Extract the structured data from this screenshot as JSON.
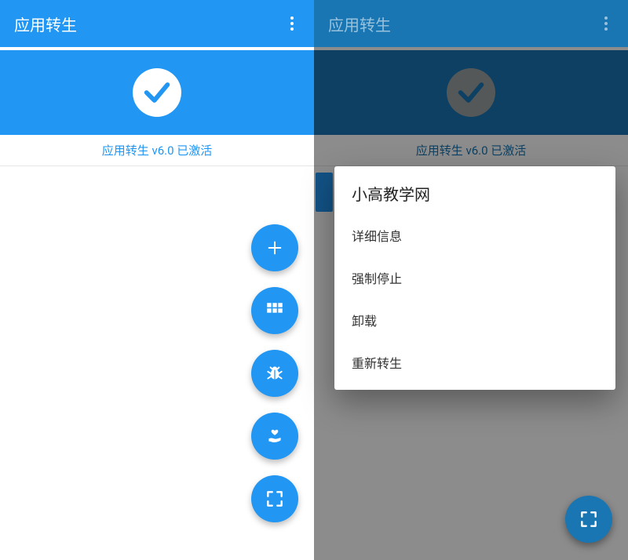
{
  "left": {
    "appbar": {
      "title": "应用转生"
    },
    "status": {
      "text": "应用转生 v6.0 已激活"
    },
    "fabs": {
      "add": "add",
      "grid": "grid",
      "bug": "bug",
      "heart": "heart-hand",
      "expand": "expand"
    }
  },
  "right": {
    "appbar": {
      "title": "应用转生"
    },
    "status": {
      "text": "应用转生 v6.0 已激活"
    },
    "dialog": {
      "title": "小高教学网",
      "items": [
        "详细信息",
        "强制停止",
        "卸载",
        "重新转生"
      ]
    }
  }
}
